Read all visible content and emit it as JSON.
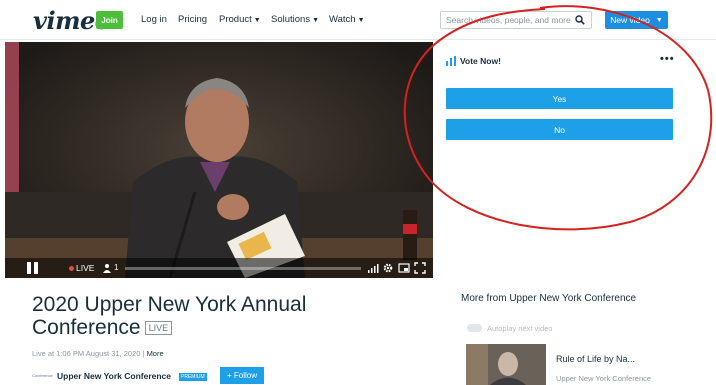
{
  "nav": {
    "logo": "vimeo",
    "join": "Join",
    "login": "Log in",
    "pricing": "Pricing",
    "product": "Product",
    "solutions": "Solutions",
    "watch": "Watch",
    "search_placeholder": "Search videos, people, and more",
    "new_video": "New video"
  },
  "player": {
    "live_label": "LIVE",
    "viewer_count": "1",
    "state": "playing"
  },
  "poll": {
    "title": "Vote Now!",
    "more": "•••",
    "options": [
      "Yes",
      "No"
    ]
  },
  "video": {
    "title": "2020 Upper New York Annual Conference",
    "live_badge": "LIVE",
    "meta": "Live at 1:06 PM August 31, 2020",
    "meta_sep": "|",
    "more_link": "More",
    "owner_logo": "Conference",
    "owner": "Upper New York Conference",
    "premium_badge": "PREMIUM",
    "follow": "+ Follow"
  },
  "sidebar": {
    "heading": "More from Upper New York Conference",
    "autoplay_label": "Autoplay next video",
    "related": [
      {
        "title": "Rule of Life by Na...",
        "owner": "Upper New York Conference"
      }
    ]
  },
  "colors": {
    "accent": "#1ea0e8",
    "join_green": "#4cbf3a",
    "live_red": "#e74c3c",
    "annotation_red": "#d32222"
  }
}
